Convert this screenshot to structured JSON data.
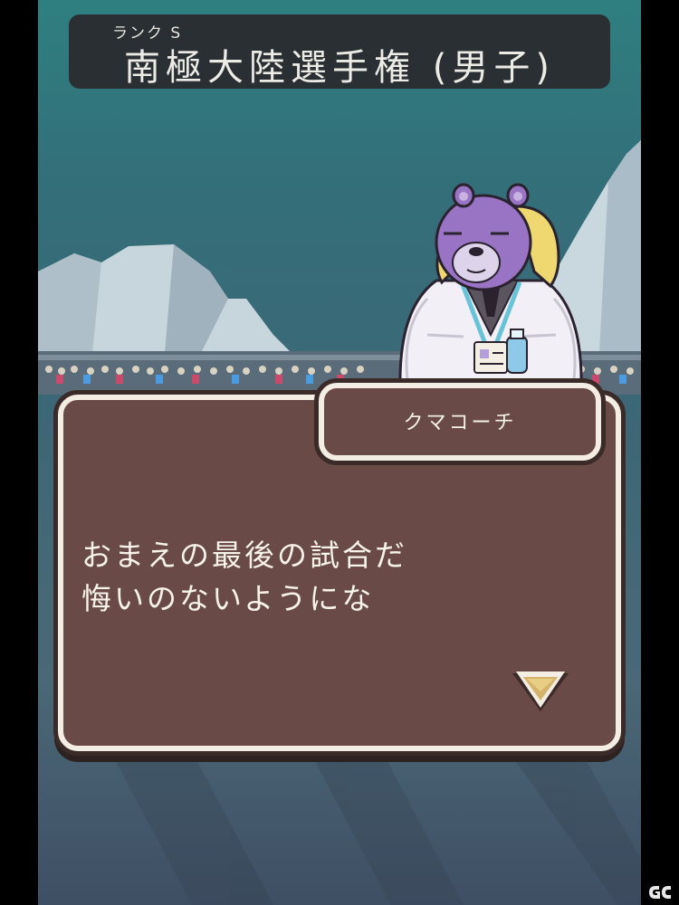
{
  "header": {
    "rank_label": "ランク S",
    "title": "南極大陸選手権 (男子)"
  },
  "dialog": {
    "speaker": "クマコーチ",
    "lines": [
      "おまえの最後の試合だ",
      "悔いのないようにな"
    ],
    "advance_icon": "triangle-down-icon"
  },
  "character": {
    "name": "クマコーチ",
    "icon": "bear-coach-icon"
  },
  "colors": {
    "sky": "#2f7f80",
    "dialog_bg": "#6a4a46",
    "dialog_border": "#f4ede4",
    "banner_bg": "#2a2f33",
    "bear_fur": "#9a74c4"
  },
  "watermark": {
    "icon": "game-logo-icon"
  }
}
